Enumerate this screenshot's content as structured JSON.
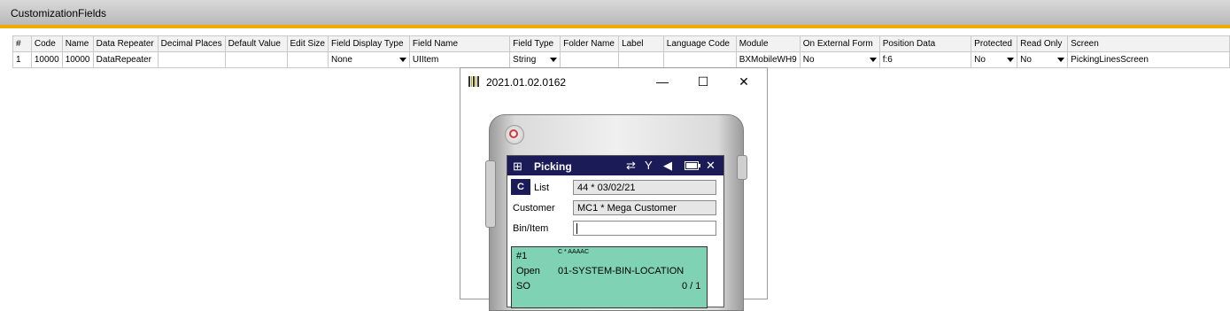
{
  "form": {
    "title": "CustomizationFields",
    "columns": [
      "#",
      "Code",
      "Name",
      "Data Repeater",
      "Decimal Places",
      "Default Value",
      "Edit Size",
      "Field Display Type",
      "Field Name",
      "Field Type",
      "Folder Name",
      "Label",
      "Language Code",
      "Module",
      "On External Form",
      "Position Data",
      "Protected",
      "Read Only",
      "Screen"
    ],
    "row": {
      "num": "1",
      "code": "10000",
      "name": "10000",
      "data_repeater": "DataRepeater",
      "decimal_places": "",
      "default_value": "",
      "edit_size": "",
      "field_display_type": "None",
      "field_name": "UIItem",
      "field_type": "String",
      "folder_name": "",
      "label": "",
      "language_code": "",
      "module": "BXMobileWH9",
      "on_external_form": "No",
      "position_data": "f:6",
      "protected": "No",
      "read_only": "No",
      "screen": "PickingLinesScreen"
    }
  },
  "emulator": {
    "window_title": "2021.01.02.0162",
    "minimize": "—",
    "maximize": "☐",
    "close": "✕",
    "app_title": "Picking",
    "c_button": "C",
    "list_label": "List",
    "list_value": "44 * 03/02/21",
    "customer_label": "Customer",
    "customer_value": "MC1 * Mega Customer",
    "binitem_label": "Bin/Item",
    "binitem_value": "",
    "line_number": "#1",
    "line_code": "C * AAAAC",
    "line_status": "Open",
    "line_bin": "01-SYSTEM-BIN-LOCATION",
    "line_doc": "SO",
    "line_qty": "0 / 1"
  },
  "icons": {
    "windows": "windows-flag-icon",
    "sync": "sync-arrows-icon",
    "signal": "signal-off-icon",
    "volume": "volume-mute-icon",
    "battery": "battery-icon",
    "close": "close-icon",
    "power": "power-icon",
    "barcode": "barcode-app-icon"
  },
  "colors": {
    "accent": "#f0ab00",
    "navbar": "#1b1b58",
    "line_bg": "#7fd3b4"
  }
}
